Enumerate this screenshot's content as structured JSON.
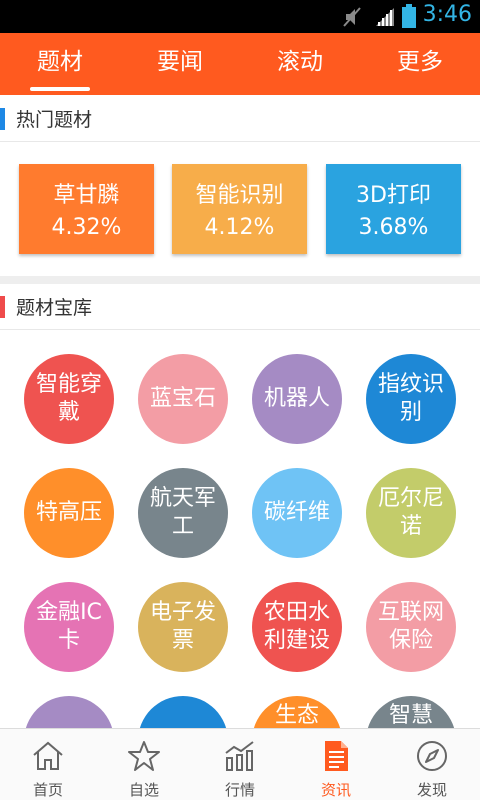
{
  "status_bar": {
    "time": "3:46"
  },
  "top_tabs": [
    {
      "label": "题材",
      "active": true
    },
    {
      "label": "要闻",
      "active": false
    },
    {
      "label": "滚动",
      "active": false
    },
    {
      "label": "更多",
      "active": false
    }
  ],
  "hot_section": {
    "title": "热门题材",
    "accent": "#1e88e5",
    "cards": [
      {
        "name": "草甘膦",
        "pct": "4.32%",
        "color": "#ff7b2e"
      },
      {
        "name": "智能识别",
        "pct": "4.12%",
        "color": "#f7ad4a"
      },
      {
        "name": "3D打印",
        "pct": "3.68%",
        "color": "#2aa3e0"
      }
    ]
  },
  "library_section": {
    "title": "题材宝库",
    "accent": "#ef4b4b",
    "items": [
      {
        "label": "智能穿戴",
        "color": "#ef5350"
      },
      {
        "label": "蓝宝石",
        "color": "#f39da5"
      },
      {
        "label": "机器人",
        "color": "#a58bc4"
      },
      {
        "label": "指纹识别",
        "color": "#1e88d6"
      },
      {
        "label": "特高压",
        "color": "#ff8f2a"
      },
      {
        "label": "航天军工",
        "color": "#78858c"
      },
      {
        "label": "碳纤维",
        "color": "#6fc3f5"
      },
      {
        "label": "厄尔尼诺",
        "color": "#c3cc6a"
      },
      {
        "label": "金融IC卡",
        "color": "#e573b4"
      },
      {
        "label": "电子发票",
        "color": "#d9b35c"
      },
      {
        "label": "农田水利建设",
        "color": "#ef5350"
      },
      {
        "label": "互联网保险",
        "color": "#f39da5"
      },
      {
        "label": "",
        "color": "#a58bc4"
      },
      {
        "label": "",
        "color": "#1e88d6"
      },
      {
        "label": "生态",
        "color": "#ff8f2a"
      },
      {
        "label": "智慧",
        "color": "#78858c"
      }
    ]
  },
  "bottom_nav": [
    {
      "label": "首页",
      "icon": "home-icon",
      "active": false
    },
    {
      "label": "自选",
      "icon": "star-icon",
      "active": false
    },
    {
      "label": "行情",
      "icon": "chart-icon",
      "active": false
    },
    {
      "label": "资讯",
      "icon": "document-icon",
      "active": true
    },
    {
      "label": "发现",
      "icon": "compass-icon",
      "active": false
    }
  ],
  "colors": {
    "brand": "#ff5a1f",
    "active_nav": "#ff5a1f",
    "status_icons": "#33b5e5"
  }
}
